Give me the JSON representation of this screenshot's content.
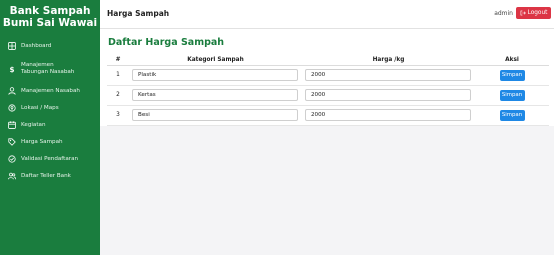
{
  "sidebar": {
    "brand_line1": "Bank Sampah",
    "brand_line2": "Bumi Sai Wawai",
    "items": [
      {
        "label": "Dashboard",
        "icon": "dashboard-icon"
      },
      {
        "label": "Manajemen Tabungan Nasabah",
        "icon": "dollar-icon"
      },
      {
        "label": "Manajemen Nasabah",
        "icon": "user-icon"
      },
      {
        "label": "Lokasi / Maps",
        "icon": "location-icon"
      },
      {
        "label": "Kegiatan",
        "icon": "calendar-icon"
      },
      {
        "label": "Harga Sampah",
        "icon": "tags-icon"
      },
      {
        "label": "Validasi Pendaftaran",
        "icon": "check-circle-icon"
      },
      {
        "label": "Daftar Teller Bank",
        "icon": "users-icon"
      }
    ]
  },
  "topbar": {
    "title": "Harga Sampah",
    "admin_name": "admin",
    "logout_label": "Logout"
  },
  "main": {
    "card_title": "Daftar Harga Sampah",
    "columns": [
      "#",
      "Kategori Sampah",
      "Harga /kg",
      "Aksi"
    ],
    "rows": [
      {
        "no": "1",
        "kategori": "Plastik",
        "harga": "2000",
        "aksi": "Simpan"
      },
      {
        "no": "2",
        "kategori": "Kertas",
        "harga": "2000",
        "aksi": "Simpan"
      },
      {
        "no": "3",
        "kategori": "Besi",
        "harga": "2000",
        "aksi": "Simpan"
      }
    ]
  },
  "colors": {
    "sidebar_green": "#1a7d3e",
    "title_green": "#1a7d3e",
    "logout_red": "#dc3545",
    "button_blue": "#1e88e5",
    "content_bg": "#f4f4f6"
  }
}
